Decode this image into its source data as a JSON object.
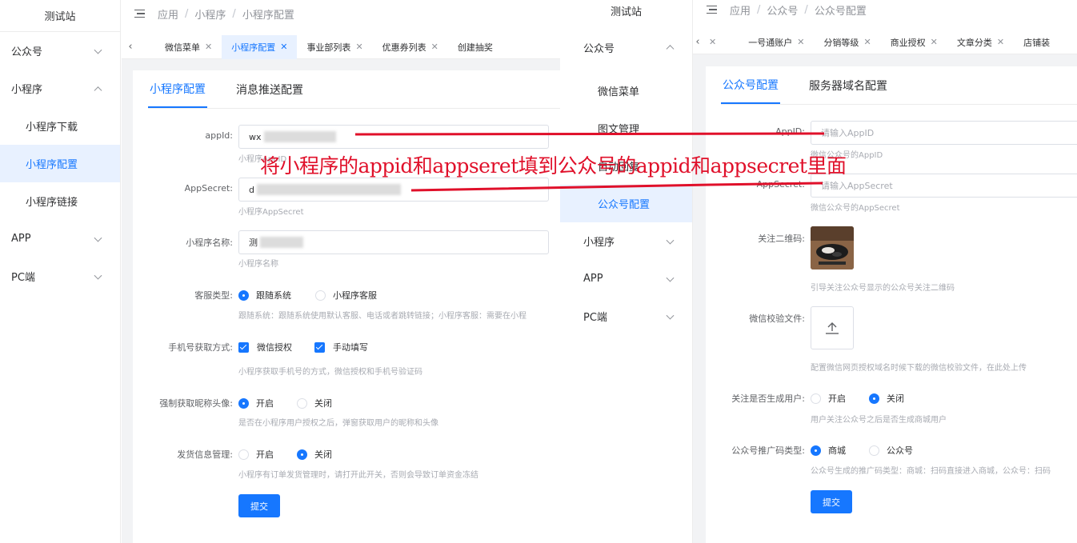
{
  "left": {
    "site_name": "测试站",
    "sidebar": [
      {
        "label": "公众号",
        "type": "group",
        "expanded": false
      },
      {
        "label": "小程序",
        "type": "group",
        "expanded": true
      },
      {
        "label": "小程序下载",
        "type": "sub"
      },
      {
        "label": "小程序配置",
        "type": "sub",
        "active": true
      },
      {
        "label": "小程序链接",
        "type": "sub"
      },
      {
        "label": "APP",
        "type": "group",
        "expanded": false
      },
      {
        "label": "PC端",
        "type": "group",
        "expanded": false
      }
    ],
    "breadcrumb": [
      "应用",
      "小程序",
      "小程序配置"
    ],
    "tabs": [
      {
        "label": "微信菜单",
        "active": false
      },
      {
        "label": "小程序配置",
        "active": true
      },
      {
        "label": "事业部列表",
        "active": false
      },
      {
        "label": "优惠券列表",
        "active": false
      },
      {
        "label": "创建抽奖",
        "active": false
      }
    ],
    "subtabs": [
      "小程序配置",
      "消息推送配置"
    ],
    "form": {
      "appid_label": "appId:",
      "appid_value": "wx",
      "appid_hint": "小程序AppID",
      "secret_label": "AppSecret:",
      "secret_value": "d",
      "secret_hint": "小程序AppSecret",
      "name_label": "小程序名称:",
      "name_value": "测",
      "name_hint": "小程序名称",
      "service_label": "客服类型:",
      "service_opt1": "跟随系统",
      "service_opt2": "小程序客服",
      "service_hint": "跟随系统：跟随系统使用默认客服、电话或者跳转链接；小程序客服：需要在小程",
      "phone_label": "手机号获取方式:",
      "phone_opt1": "微信授权",
      "phone_opt2": "手动填写",
      "phone_hint": "小程序获取手机号的方式，微信授权和手机号验证码",
      "avatar_label": "强制获取昵称头像:",
      "avatar_opt1": "开启",
      "avatar_opt2": "关闭",
      "avatar_hint": "是否在小程序用户授权之后，弹窗获取用户的昵称和头像",
      "ship_label": "发货信息管理:",
      "ship_opt1": "开启",
      "ship_opt2": "关闭",
      "ship_hint": "小程序有订单发货管理时，请打开此开关，否则会导致订单资金冻结",
      "submit": "提交"
    }
  },
  "right": {
    "site_name": "测试站",
    "sidebar": [
      {
        "label": "公众号",
        "type": "group",
        "expanded": true
      },
      {
        "label": "微信菜单",
        "type": "sub"
      },
      {
        "label": "图文管理",
        "type": "sub"
      },
      {
        "label": "自动回复",
        "type": "sub"
      },
      {
        "label": "公众号配置",
        "type": "sub",
        "active": true
      },
      {
        "label": "小程序",
        "type": "group",
        "expanded": false
      },
      {
        "label": "APP",
        "type": "group",
        "expanded": false
      },
      {
        "label": "PC端",
        "type": "group",
        "expanded": false
      }
    ],
    "breadcrumb": [
      "应用",
      "公众号",
      "公众号配置"
    ],
    "tabs": [
      {
        "label": "",
        "active": false
      },
      {
        "label": "一号通账户",
        "active": false
      },
      {
        "label": "分销等级",
        "active": false
      },
      {
        "label": "商业授权",
        "active": false
      },
      {
        "label": "文章分类",
        "active": false
      },
      {
        "label": "店铺装",
        "active": false
      }
    ],
    "subtabs": [
      "公众号配置",
      "服务器域名配置"
    ],
    "form": {
      "appid_label": "AppID:",
      "appid_placeholder": "请输入AppID",
      "appid_hint": "微信公众号的AppID",
      "secret_label": "AppSecret:",
      "secret_placeholder": "请输入AppSecret",
      "secret_hint": "微信公众号的AppSecret",
      "qr_label": "关注二维码:",
      "qr_hint": "引导关注公众号显示的公众号关注二维码",
      "verify_label": "微信校验文件:",
      "verify_hint": "配置微信网页授权域名时候下载的微信校验文件，在此处上传",
      "gen_label": "关注是否生成用户:",
      "gen_opt1": "开启",
      "gen_opt2": "关闭",
      "gen_hint": "用户关注公众号之后是否生成商城用户",
      "promo_label": "公众号推广码类型:",
      "promo_opt1": "商城",
      "promo_opt2": "公众号",
      "promo_hint": "公众号生成的推广码类型：商城：扫码直接进入商城，公众号：扫码",
      "submit": "提交"
    }
  },
  "annotation": {
    "text": "将小程序的appid和appseret填到公众号的appid和appsecret里面",
    "color": "#e0102a"
  }
}
